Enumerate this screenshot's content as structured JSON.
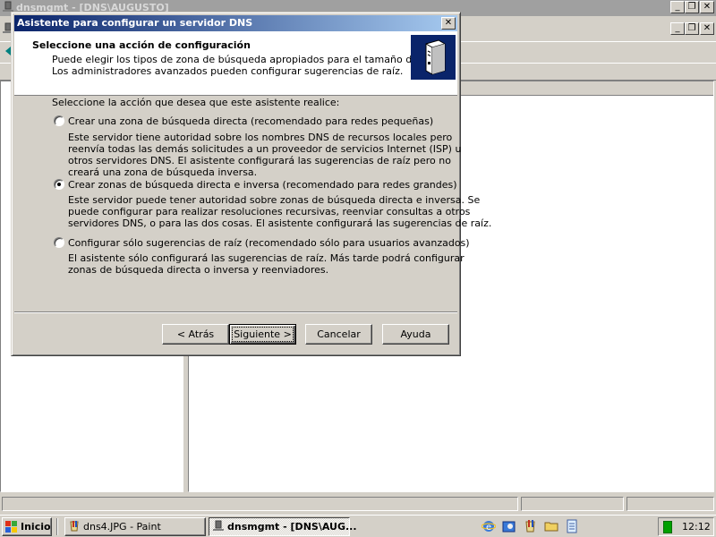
{
  "background_window": {
    "title": "dnsmgmt - [DNS\\AUGUSTO]"
  },
  "dialog": {
    "title": "Asistente para configurar un servidor DNS",
    "header": {
      "title": "Seleccione una acción de configuración",
      "subtitle_line1": "Puede elegir los tipos de zona de búsqueda apropiados para el tamaño de la red.",
      "subtitle_line2": "Los administradores avanzados pueden configurar sugerencias de raíz."
    },
    "prompt": "Seleccione la acción que desea que este asistente realice:",
    "options": [
      {
        "label": "Crear una zona de búsqueda directa (recomendado para redes pequeñas)",
        "selected": false,
        "description": [
          "Este servidor tiene autoridad sobre los nombres DNS de recursos locales pero",
          "reenvía todas las demás solicitudes a un proveedor de servicios Internet (ISP) u",
          "otros servidores DNS. El asistente configurará las sugerencias de raíz pero no",
          "creará una zona de búsqueda inversa."
        ]
      },
      {
        "label": "Crear zonas de búsqueda directa e inversa (recomendado para redes grandes)",
        "selected": true,
        "description": [
          "Este servidor puede tener autoridad sobre zonas de búsqueda directa e inversa. Se",
          "puede configurar para realizar resoluciones recursivas, reenviar consultas a otros",
          "servidores DNS, o para las dos cosas. El asistente configurará las sugerencias de raíz."
        ]
      },
      {
        "label": "Configurar sólo sugerencias de raíz (recomendado sólo para usuarios avanzados)",
        "selected": false,
        "description": [
          "El asistente sólo configurará las sugerencias de raíz. Más tarde podrá configurar",
          "zonas de búsqueda directa o inversa y reenviadores."
        ]
      }
    ],
    "buttons": {
      "back": "< Atrás",
      "next": "Siguiente >",
      "cancel": "Cancelar",
      "help": "Ayuda"
    }
  },
  "taskbar": {
    "start": "Inicio",
    "tasks": [
      {
        "label": "dns4.JPG - Paint",
        "active": false
      },
      {
        "label": "dnsmgmt - [DNS\\AUG...",
        "active": true
      }
    ],
    "clock": "12:12"
  },
  "colors": {
    "titlebar_active_start": "#0a246a",
    "titlebar_active_end": "#a6caf0",
    "face": "#d4d0c8"
  }
}
